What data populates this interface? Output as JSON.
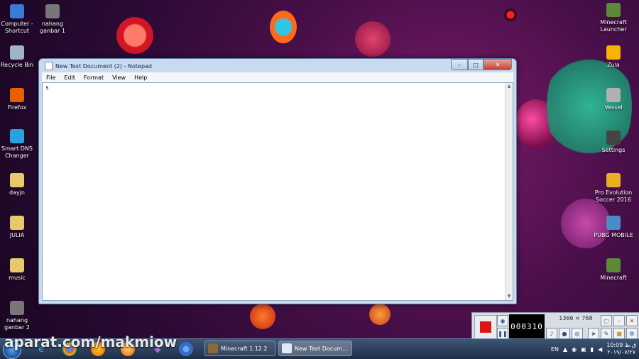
{
  "desktop": {
    "left_icons": [
      {
        "label": "Computer - Shortcut",
        "icon": "computer-icon",
        "color": "#3a7bd5"
      },
      {
        "label": "nahang ganbar 1",
        "icon": "video-file-icon",
        "color": "#777777"
      },
      {
        "label": "Recycle Bin",
        "icon": "recycle-bin-icon",
        "color": "#9fb4c8"
      },
      {
        "label": "Firefox",
        "icon": "firefox-icon",
        "color": "#e66000"
      },
      {
        "label": "Smart DNS Changer",
        "icon": "dns-changer-icon",
        "color": "#29a3e0"
      },
      {
        "label": "dayjn",
        "icon": "folder-icon",
        "color": "#e8c86a"
      },
      {
        "label": "JULIA",
        "icon": "folder-icon",
        "color": "#e8c86a"
      },
      {
        "label": "music",
        "icon": "folder-icon",
        "color": "#e8c86a"
      },
      {
        "label": "nahang ganbar 2",
        "icon": "video-file-icon",
        "color": "#777777"
      }
    ],
    "right_icons": [
      {
        "label": "Minecraft Launcher",
        "icon": "minecraft-launcher-icon",
        "color": "#5c8a3a"
      },
      {
        "label": "Zula",
        "icon": "zula-icon",
        "color": "#f4b400"
      },
      {
        "label": "Vessel",
        "icon": "vessel-icon",
        "color": "#b0b0b0"
      },
      {
        "label": "Settings",
        "icon": "settings-icon",
        "color": "#444444"
      },
      {
        "label": "Pro Evolution Soccer 2016",
        "icon": "pes-icon",
        "color": "#e8b020"
      },
      {
        "label": "PUBG MOBILE",
        "icon": "pubg-icon",
        "color": "#4a8bc8"
      },
      {
        "label": "Minecraft",
        "icon": "minecraft-icon",
        "color": "#5c8a3a"
      }
    ]
  },
  "notepad": {
    "title": "New Text Document (2) - Notepad",
    "menu": [
      "File",
      "Edit",
      "Format",
      "View",
      "Help"
    ],
    "content": "s",
    "controls": {
      "minimize": "–",
      "maximize": "□",
      "close": "✕"
    }
  },
  "recorder": {
    "timer": "000310",
    "size": "1366 × 768"
  },
  "taskbar": {
    "tasks": [
      {
        "label": "Minecraft 1.12.2"
      },
      {
        "label": "New Text Docum..."
      }
    ],
    "language": "EN",
    "time": "10:09 ق.ظ",
    "date": "۲۰۱۹/۰۷/۲۷"
  },
  "watermark": "aparat.com/makmiow"
}
